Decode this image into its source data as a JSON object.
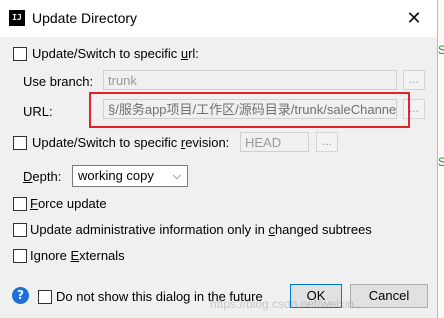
{
  "window": {
    "title": "Update Directory",
    "app_icon": "IJ",
    "close_glyph": "✕"
  },
  "url_group": {
    "checkbox_label_prefix": "Update/Switch to specific ",
    "checkbox_label_key": "u",
    "checkbox_label_suffix": "rl:",
    "checked": false,
    "use_branch_label": "Use branch:",
    "use_branch_value": "trunk",
    "url_label": "URL:",
    "url_value": "§/服务app项目/工作区/源码目录/trunk/saleChannel",
    "browse_label": "..."
  },
  "revision_group": {
    "checkbox_label_prefix": "Update/Switch to specific ",
    "checkbox_label_key": "r",
    "checkbox_label_suffix": "evision:",
    "checked": false,
    "revision_value": "HEAD",
    "browse_label": "..."
  },
  "depth": {
    "label_key": "D",
    "label_rest": "epth:",
    "selected": "working copy",
    "arrow": "⌵"
  },
  "options": [
    {
      "key": "F",
      "rest": "orce update",
      "checked": false
    },
    {
      "prefix": "Update administrative information only in ",
      "key": "c",
      "rest": "hanged subtrees",
      "checked": false
    },
    {
      "prefix": "Ignore ",
      "key": "E",
      "rest": "xternals",
      "checked": false
    }
  ],
  "footer": {
    "help_glyph": "?",
    "do_not_show_label": "Do not show this dialog in the future",
    "ok_label": "OK",
    "cancel_label": "Cancel"
  },
  "watermark_text": "https://blog.csdn.net/weixin...",
  "side_strip": {
    "s1": "S",
    "s2": "S"
  },
  "colors": {
    "highlight_border": "#e0242a",
    "help_blue": "#1e6fd9"
  }
}
